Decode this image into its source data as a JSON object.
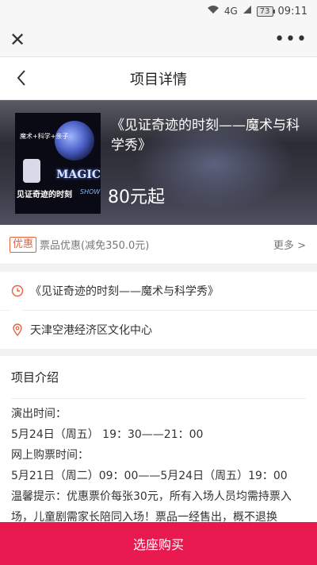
{
  "status_bar": {
    "signal_label": "4G",
    "battery": "73",
    "time": "09:11"
  },
  "web_bar": {
    "more_label": "•••"
  },
  "nav": {
    "title": "项目详情"
  },
  "hero": {
    "show_name": "《见证奇迹的时刻——魔术与科学秀》",
    "price": "80元起",
    "poster": {
      "tagline": "魔术+科学+亲子",
      "magic_text": "MAGIC",
      "cn_title": "见证奇迹的时刻",
      "show_text": "SHOW"
    }
  },
  "promo": {
    "badge": "优惠",
    "text": "票品优惠(减免350.0元)",
    "more": "更多 >"
  },
  "info": {
    "event_name": "《见证奇迹的时刻——魔术与科学秀》",
    "venue": "天津空港经济区文化中心"
  },
  "intro": {
    "heading": "项目介绍",
    "lines": [
      "演出时间：",
      "5月24日（周五） 19：30——21：00",
      "网上购票时间：",
      "5月21日（周二）09：00——5月24日（周五）19：00",
      "温馨提示：优惠票价每张30元，所有入场人员均需持票入场，儿童剧需家长陪同入场！票品一经售出，概不退换"
    ]
  },
  "buy_button": {
    "label": "选座购买"
  },
  "colors": {
    "accent": "#e8194f",
    "promo": "#e8603c"
  }
}
